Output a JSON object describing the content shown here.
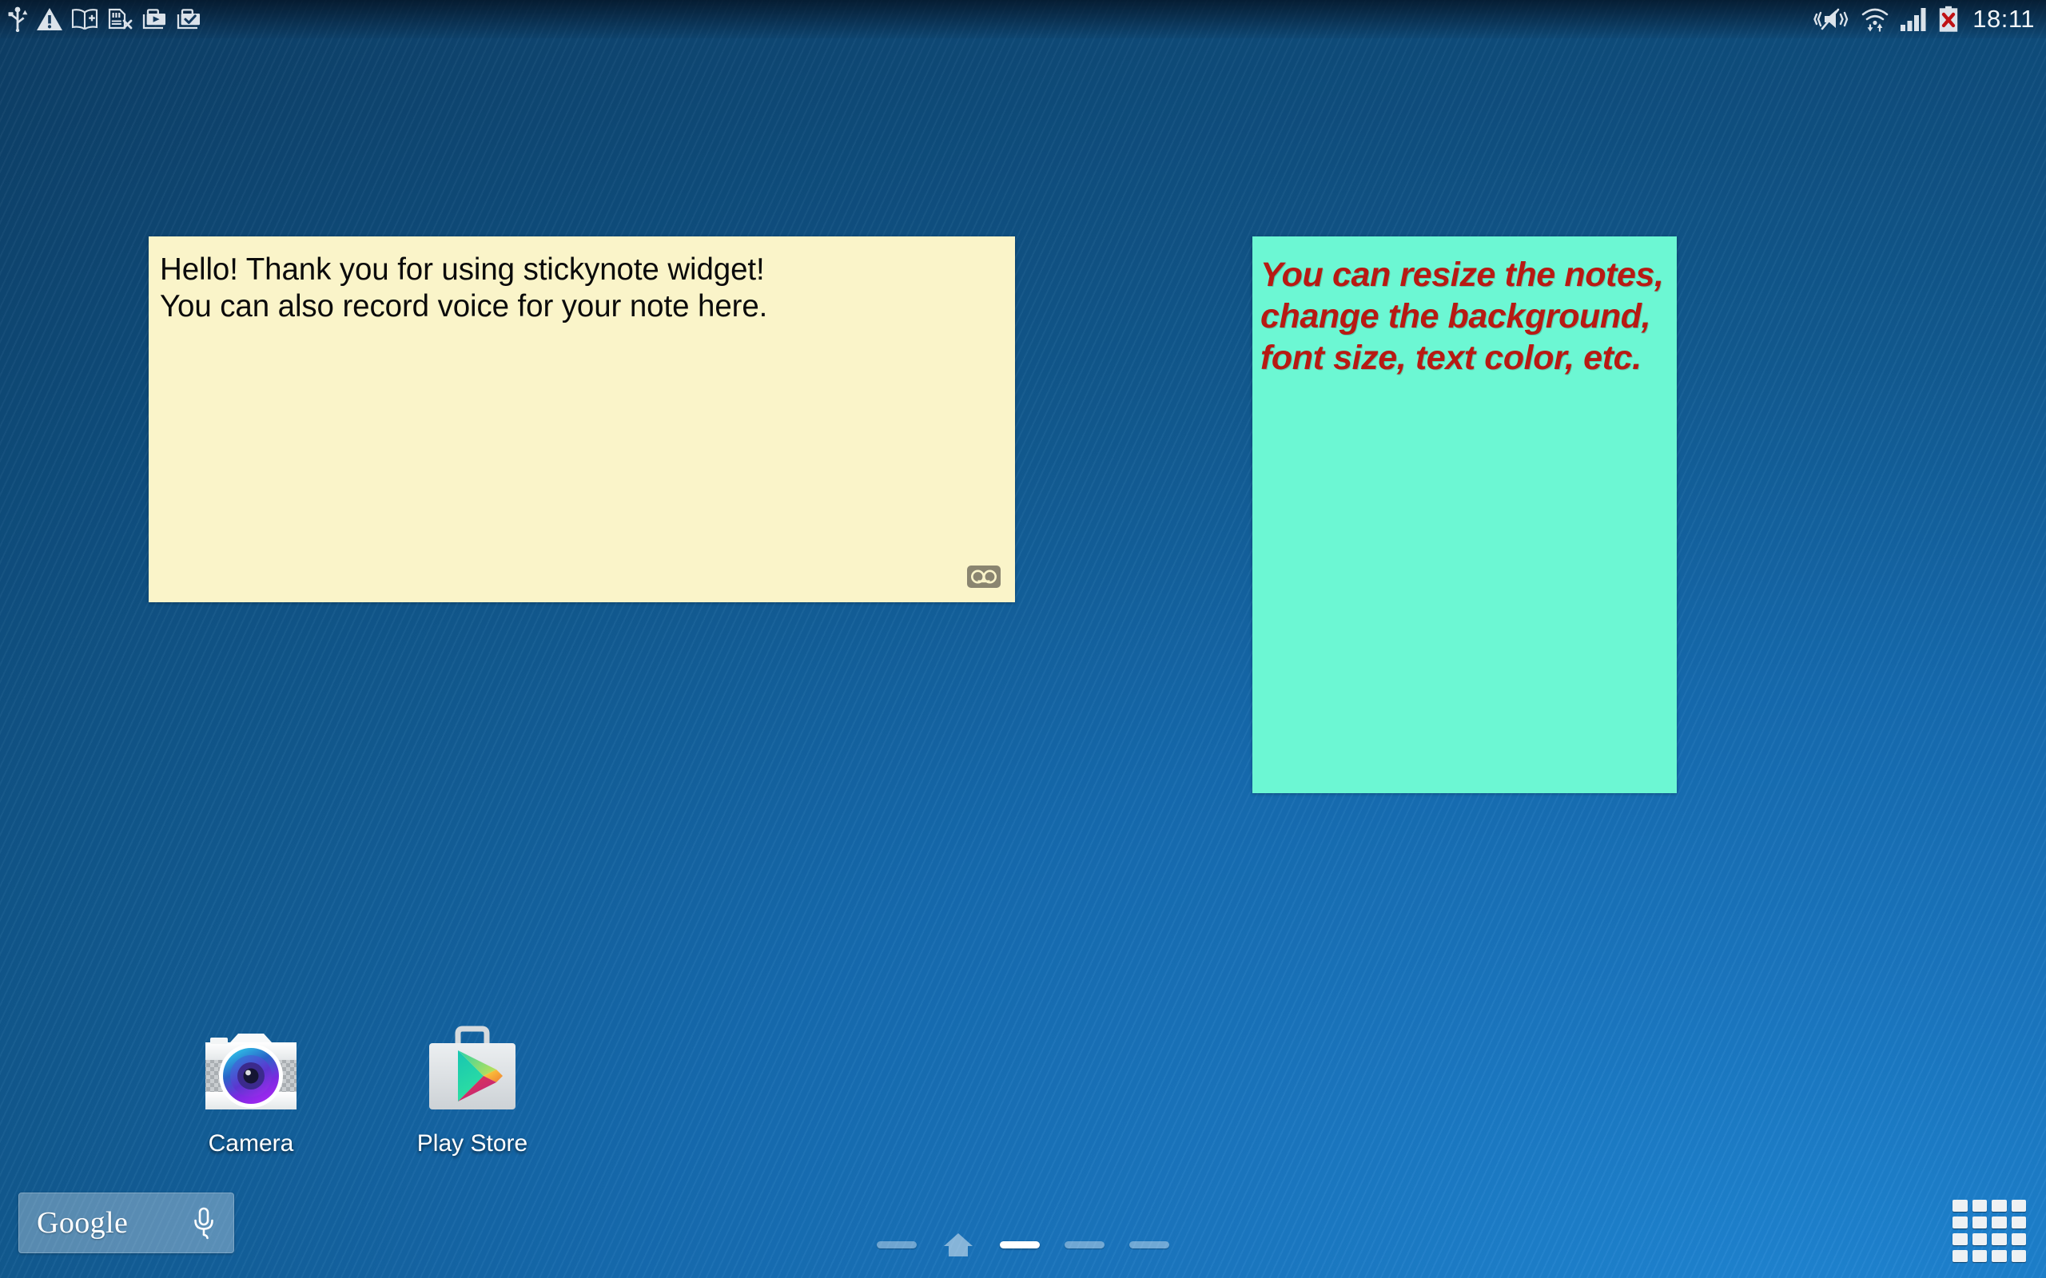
{
  "status_bar": {
    "clock": "18:11",
    "notification_icons": [
      {
        "name": "usb-icon",
        "label": "USB connected"
      },
      {
        "name": "warning-icon",
        "label": "Warning"
      },
      {
        "name": "book-add-icon",
        "label": "Add to book"
      },
      {
        "name": "sdcard-removed-icon",
        "label": "SD card removed"
      },
      {
        "name": "briefcase-play-icon",
        "label": "Work media"
      },
      {
        "name": "briefcase-check-icon",
        "label": "Work verified"
      }
    ],
    "system_icons": [
      {
        "name": "vibrate-mute-icon",
        "label": "Sound off / vibrate"
      },
      {
        "name": "wifi-data-icon",
        "label": "Wi-Fi with data transfer"
      },
      {
        "name": "signal-bars-icon",
        "label": "Mobile signal"
      },
      {
        "name": "battery-error-icon",
        "label": "Battery not charging"
      }
    ]
  },
  "notes": [
    {
      "id": "yellow",
      "text": "Hello! Thank you for using stickynote widget!\nYou can also record voice for your note here.",
      "background": "#FAF4C9",
      "text_color": "#0b0b0b",
      "voice_icon": "voice-recorder-icon"
    },
    {
      "id": "green",
      "text": "You can resize the notes, change the background, font size, text color, etc.",
      "background": "#6CF7D3",
      "text_color": "#B71A13"
    }
  ],
  "apps": [
    {
      "name": "camera",
      "label": "Camera"
    },
    {
      "name": "playstore",
      "label": "Play Store"
    }
  ],
  "search_widget": {
    "wordmark": "Google",
    "mic_icon": "microphone-icon"
  },
  "page_indicator": {
    "pages": 5,
    "active_index": 2,
    "home_index": 1
  },
  "app_drawer": {
    "icon": "apps-grid-icon"
  },
  "wallpaper": {
    "accent_dark": "#0c3357",
    "accent_light": "#1f86d4"
  }
}
